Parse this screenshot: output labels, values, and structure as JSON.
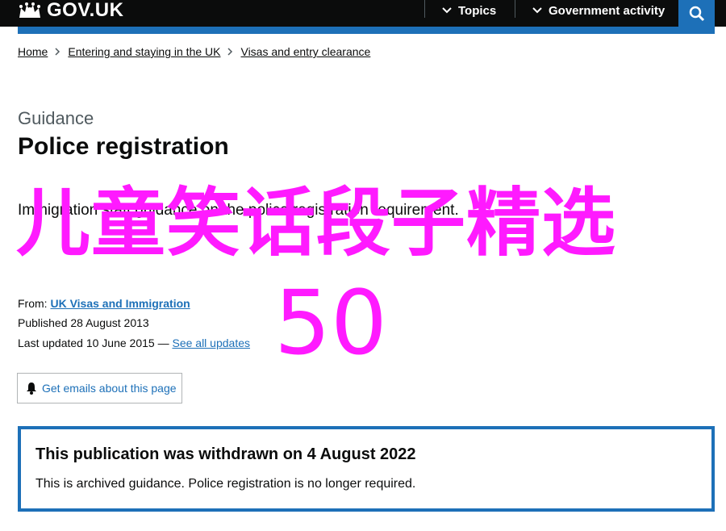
{
  "header": {
    "logo_text": "GOV.UK",
    "nav": [
      {
        "label": "Topics"
      },
      {
        "label": "Government activity"
      }
    ]
  },
  "breadcrumb": [
    "Home",
    "Entering and staying in the UK",
    "Visas and entry clearance"
  ],
  "page": {
    "caption": "Guidance",
    "title": "Police registration",
    "lead": "Immigration staff guidance on the police registration requirement."
  },
  "meta": {
    "from_label": "From:",
    "from_link": "UK Visas and Immigration",
    "published": "Published 28 August 2013",
    "updated": "Last updated 10 June 2015 —",
    "updates_link": "See all updates"
  },
  "emails_button": "Get emails about this page",
  "notice": {
    "title": "This publication was withdrawn on 4 August 2022",
    "body": "This is archived guidance. Police registration is no longer required."
  },
  "overlay": {
    "line1": "儿童笑话段子精选",
    "line2": "50"
  },
  "colors": {
    "brand_blue": "#1d70b8",
    "header_black": "#0b0c0c",
    "overlay_magenta": "#ff1aff"
  }
}
